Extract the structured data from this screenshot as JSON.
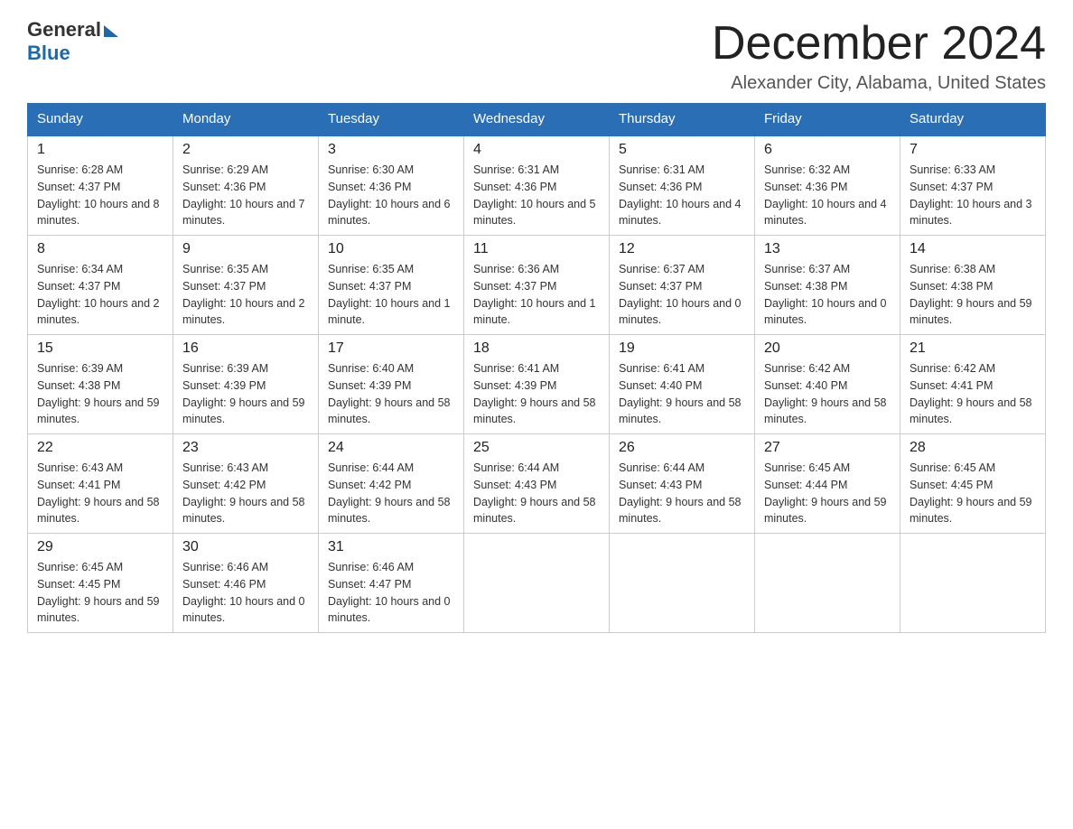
{
  "header": {
    "logo_general": "General",
    "logo_blue": "Blue",
    "main_title": "December 2024",
    "subtitle": "Alexander City, Alabama, United States"
  },
  "calendar": {
    "days_of_week": [
      "Sunday",
      "Monday",
      "Tuesday",
      "Wednesday",
      "Thursday",
      "Friday",
      "Saturday"
    ],
    "weeks": [
      [
        {
          "day": "1",
          "sunrise": "6:28 AM",
          "sunset": "4:37 PM",
          "daylight": "10 hours and 8 minutes."
        },
        {
          "day": "2",
          "sunrise": "6:29 AM",
          "sunset": "4:36 PM",
          "daylight": "10 hours and 7 minutes."
        },
        {
          "day": "3",
          "sunrise": "6:30 AM",
          "sunset": "4:36 PM",
          "daylight": "10 hours and 6 minutes."
        },
        {
          "day": "4",
          "sunrise": "6:31 AM",
          "sunset": "4:36 PM",
          "daylight": "10 hours and 5 minutes."
        },
        {
          "day": "5",
          "sunrise": "6:31 AM",
          "sunset": "4:36 PM",
          "daylight": "10 hours and 4 minutes."
        },
        {
          "day": "6",
          "sunrise": "6:32 AM",
          "sunset": "4:36 PM",
          "daylight": "10 hours and 4 minutes."
        },
        {
          "day": "7",
          "sunrise": "6:33 AM",
          "sunset": "4:37 PM",
          "daylight": "10 hours and 3 minutes."
        }
      ],
      [
        {
          "day": "8",
          "sunrise": "6:34 AM",
          "sunset": "4:37 PM",
          "daylight": "10 hours and 2 minutes."
        },
        {
          "day": "9",
          "sunrise": "6:35 AM",
          "sunset": "4:37 PM",
          "daylight": "10 hours and 2 minutes."
        },
        {
          "day": "10",
          "sunrise": "6:35 AM",
          "sunset": "4:37 PM",
          "daylight": "10 hours and 1 minute."
        },
        {
          "day": "11",
          "sunrise": "6:36 AM",
          "sunset": "4:37 PM",
          "daylight": "10 hours and 1 minute."
        },
        {
          "day": "12",
          "sunrise": "6:37 AM",
          "sunset": "4:37 PM",
          "daylight": "10 hours and 0 minutes."
        },
        {
          "day": "13",
          "sunrise": "6:37 AM",
          "sunset": "4:38 PM",
          "daylight": "10 hours and 0 minutes."
        },
        {
          "day": "14",
          "sunrise": "6:38 AM",
          "sunset": "4:38 PM",
          "daylight": "9 hours and 59 minutes."
        }
      ],
      [
        {
          "day": "15",
          "sunrise": "6:39 AM",
          "sunset": "4:38 PM",
          "daylight": "9 hours and 59 minutes."
        },
        {
          "day": "16",
          "sunrise": "6:39 AM",
          "sunset": "4:39 PM",
          "daylight": "9 hours and 59 minutes."
        },
        {
          "day": "17",
          "sunrise": "6:40 AM",
          "sunset": "4:39 PM",
          "daylight": "9 hours and 58 minutes."
        },
        {
          "day": "18",
          "sunrise": "6:41 AM",
          "sunset": "4:39 PM",
          "daylight": "9 hours and 58 minutes."
        },
        {
          "day": "19",
          "sunrise": "6:41 AM",
          "sunset": "4:40 PM",
          "daylight": "9 hours and 58 minutes."
        },
        {
          "day": "20",
          "sunrise": "6:42 AM",
          "sunset": "4:40 PM",
          "daylight": "9 hours and 58 minutes."
        },
        {
          "day": "21",
          "sunrise": "6:42 AM",
          "sunset": "4:41 PM",
          "daylight": "9 hours and 58 minutes."
        }
      ],
      [
        {
          "day": "22",
          "sunrise": "6:43 AM",
          "sunset": "4:41 PM",
          "daylight": "9 hours and 58 minutes."
        },
        {
          "day": "23",
          "sunrise": "6:43 AM",
          "sunset": "4:42 PM",
          "daylight": "9 hours and 58 minutes."
        },
        {
          "day": "24",
          "sunrise": "6:44 AM",
          "sunset": "4:42 PM",
          "daylight": "9 hours and 58 minutes."
        },
        {
          "day": "25",
          "sunrise": "6:44 AM",
          "sunset": "4:43 PM",
          "daylight": "9 hours and 58 minutes."
        },
        {
          "day": "26",
          "sunrise": "6:44 AM",
          "sunset": "4:43 PM",
          "daylight": "9 hours and 58 minutes."
        },
        {
          "day": "27",
          "sunrise": "6:45 AM",
          "sunset": "4:44 PM",
          "daylight": "9 hours and 59 minutes."
        },
        {
          "day": "28",
          "sunrise": "6:45 AM",
          "sunset": "4:45 PM",
          "daylight": "9 hours and 59 minutes."
        }
      ],
      [
        {
          "day": "29",
          "sunrise": "6:45 AM",
          "sunset": "4:45 PM",
          "daylight": "9 hours and 59 minutes."
        },
        {
          "day": "30",
          "sunrise": "6:46 AM",
          "sunset": "4:46 PM",
          "daylight": "10 hours and 0 minutes."
        },
        {
          "day": "31",
          "sunrise": "6:46 AM",
          "sunset": "4:47 PM",
          "daylight": "10 hours and 0 minutes."
        },
        null,
        null,
        null,
        null
      ]
    ]
  }
}
